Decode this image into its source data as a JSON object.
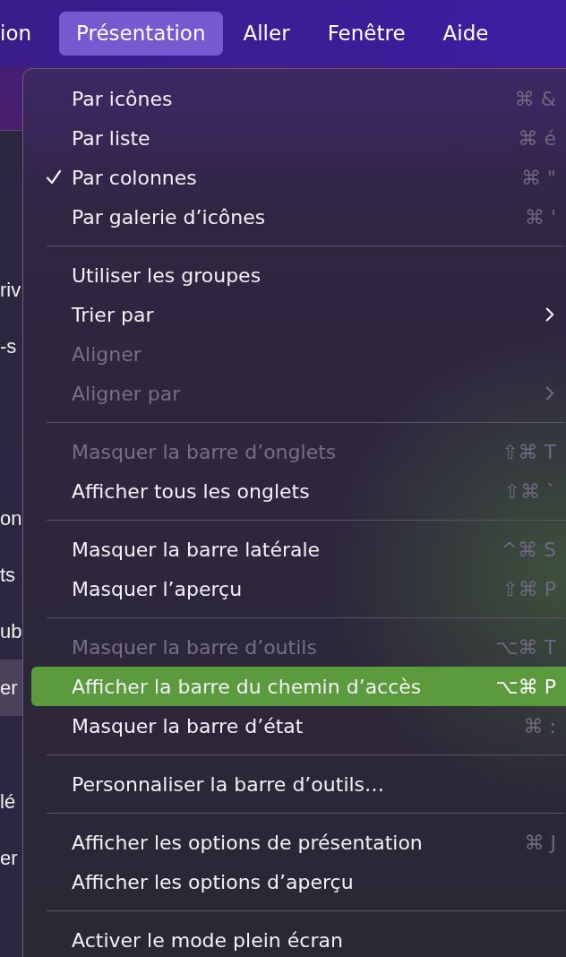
{
  "menu_bar": [
    {
      "label": "ion",
      "selected": false
    },
    {
      "label": "Présentation",
      "selected": true
    },
    {
      "label": "Aller",
      "selected": false
    },
    {
      "label": "Fenêtre",
      "selected": false
    },
    {
      "label": "Aide",
      "selected": false
    }
  ],
  "sidebar": {
    "groups": [
      [
        {
          "label": "riv",
          "selected": false
        },
        {
          "label": "-s",
          "selected": false
        }
      ],
      [
        {
          "label": "on",
          "selected": false
        },
        {
          "label": "ts",
          "selected": false
        },
        {
          "label": "ub",
          "selected": false
        },
        {
          "label": "er",
          "selected": true
        }
      ],
      [
        {
          "label": "lé",
          "selected": false
        },
        {
          "label": "er",
          "selected": false
        }
      ]
    ]
  },
  "menu": {
    "sections": [
      [
        {
          "label": "Par icônes",
          "shortcut": "⌘ &",
          "checked": false,
          "disabled": false,
          "selected": false,
          "submenu": false
        },
        {
          "label": "Par liste",
          "shortcut": "⌘ é",
          "checked": false,
          "disabled": false,
          "selected": false,
          "submenu": false
        },
        {
          "label": "Par colonnes",
          "shortcut": "⌘ \"",
          "checked": true,
          "disabled": false,
          "selected": false,
          "submenu": false
        },
        {
          "label": "Par galerie d’icônes",
          "shortcut": "⌘ '",
          "checked": false,
          "disabled": false,
          "selected": false,
          "submenu": false
        }
      ],
      [
        {
          "label": "Utiliser les groupes",
          "checked": false,
          "disabled": false,
          "selected": false,
          "submenu": false
        },
        {
          "label": "Trier par",
          "checked": false,
          "disabled": false,
          "selected": false,
          "submenu": true
        },
        {
          "label": "Aligner",
          "checked": false,
          "disabled": true,
          "selected": false,
          "submenu": false
        },
        {
          "label": "Aligner par",
          "checked": false,
          "disabled": true,
          "selected": false,
          "submenu": true
        }
      ],
      [
        {
          "label": "Masquer la barre d’onglets",
          "shortcut": "⇧⌘ T",
          "checked": false,
          "disabled": true,
          "selected": false,
          "submenu": false
        },
        {
          "label": "Afficher tous les onglets",
          "shortcut": "⇧⌘ `",
          "checked": false,
          "disabled": false,
          "selected": false,
          "submenu": false
        }
      ],
      [
        {
          "label": "Masquer la barre latérale",
          "shortcut": "^⌘ S",
          "checked": false,
          "disabled": false,
          "selected": false,
          "submenu": false
        },
        {
          "label": "Masquer l’aperçu",
          "shortcut": "⇧⌘ P",
          "checked": false,
          "disabled": false,
          "selected": false,
          "submenu": false
        }
      ],
      [
        {
          "label": "Masquer la barre d’outils",
          "shortcut": "⌥⌘ T",
          "checked": false,
          "disabled": true,
          "selected": false,
          "submenu": false
        },
        {
          "label": "Afficher la barre du chemin d’accès",
          "shortcut": "⌥⌘ P",
          "checked": false,
          "disabled": false,
          "selected": true,
          "submenu": false
        },
        {
          "label": "Masquer la barre d’état",
          "shortcut": "⌘ :",
          "checked": false,
          "disabled": false,
          "selected": false,
          "submenu": false
        }
      ],
      [
        {
          "label": "Personnaliser la barre d’outils…",
          "checked": false,
          "disabled": false,
          "selected": false,
          "submenu": false
        }
      ],
      [
        {
          "label": "Afficher les options de présentation",
          "shortcut": "⌘ J",
          "checked": false,
          "disabled": false,
          "selected": false,
          "submenu": false
        },
        {
          "label": "Afficher les options d’aperçu",
          "checked": false,
          "disabled": false,
          "selected": false,
          "submenu": false
        }
      ],
      [
        {
          "label": "Activer le mode plein écran",
          "checked": false,
          "disabled": false,
          "selected": false,
          "submenu": false
        }
      ]
    ]
  }
}
